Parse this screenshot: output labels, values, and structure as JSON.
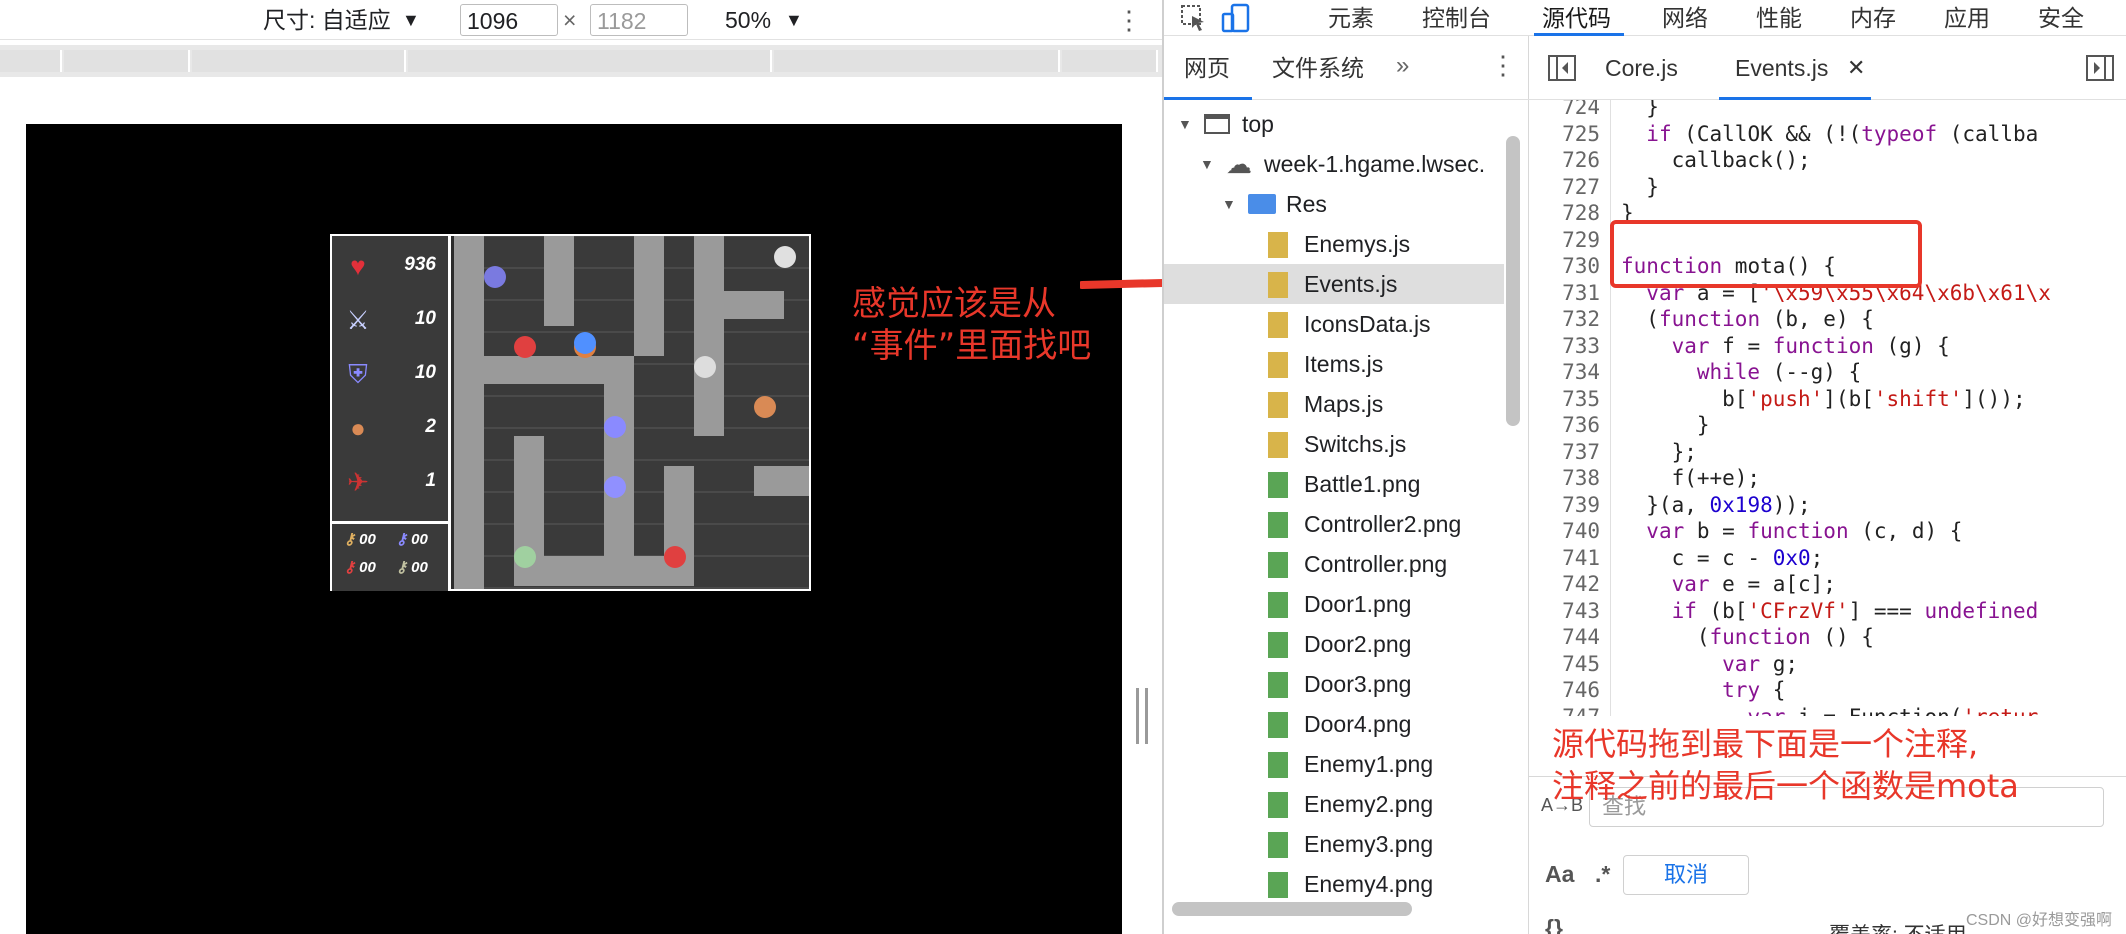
{
  "device_toolbar": {
    "dimensions_label": "尺寸: 自适应",
    "width_value": "1096",
    "height_placeholder": "1182",
    "times_sign": "×",
    "zoom_label": "50%"
  },
  "game": {
    "stats": [
      {
        "icon": "heart-icon",
        "value": "936"
      },
      {
        "icon": "sword-icon",
        "value": "10"
      },
      {
        "icon": "shield-icon",
        "value": "10"
      },
      {
        "icon": "coin-icon",
        "value": "2"
      },
      {
        "icon": "boot-icon",
        "value": "1"
      }
    ],
    "keys": [
      {
        "icon": "yellow-key-icon",
        "value": "00"
      },
      {
        "icon": "blue-key-icon",
        "value": "00"
      },
      {
        "icon": "red-key-icon",
        "value": "00"
      },
      {
        "icon": "green-key-icon",
        "value": "00"
      }
    ]
  },
  "annotations": {
    "left_line1": "感觉应该是从",
    "left_line2": "“事件”里面找吧",
    "right_line1": "源代码拖到最下面是一个注释,",
    "right_line2": "注释之前的最后一个函数是mota"
  },
  "devtools": {
    "tabs": [
      "元素",
      "控制台",
      "源代码",
      "网络",
      "性能",
      "内存",
      "应用",
      "安全"
    ],
    "active_tab": "源代码",
    "navigator": {
      "tabs": [
        "网页",
        "文件系统"
      ],
      "more": "»",
      "tree": [
        {
          "label": "top",
          "indent": 0,
          "icon": "frame-icon",
          "expanded": true
        },
        {
          "label": "week-1.hgame.lwsec.",
          "indent": 1,
          "icon": "cloud-icon",
          "expanded": true
        },
        {
          "label": "Res",
          "indent": 2,
          "icon": "folder-icon",
          "expanded": true
        },
        {
          "label": "Enemys.js",
          "indent": 3,
          "icon": "js-file-icon"
        },
        {
          "label": "Events.js",
          "indent": 3,
          "icon": "js-file-icon",
          "selected": true
        },
        {
          "label": "IconsData.js",
          "indent": 3,
          "icon": "js-file-icon"
        },
        {
          "label": "Items.js",
          "indent": 3,
          "icon": "js-file-icon"
        },
        {
          "label": "Maps.js",
          "indent": 3,
          "icon": "js-file-icon"
        },
        {
          "label": "Switchs.js",
          "indent": 3,
          "icon": "js-file-icon"
        },
        {
          "label": "Battle1.png",
          "indent": 3,
          "icon": "image-file-icon"
        },
        {
          "label": "Controller2.png",
          "indent": 3,
          "icon": "image-file-icon"
        },
        {
          "label": "Controller.png",
          "indent": 3,
          "icon": "image-file-icon"
        },
        {
          "label": "Door1.png",
          "indent": 3,
          "icon": "image-file-icon"
        },
        {
          "label": "Door2.png",
          "indent": 3,
          "icon": "image-file-icon"
        },
        {
          "label": "Door3.png",
          "indent": 3,
          "icon": "image-file-icon"
        },
        {
          "label": "Door4.png",
          "indent": 3,
          "icon": "image-file-icon"
        },
        {
          "label": "Enemy1.png",
          "indent": 3,
          "icon": "image-file-icon"
        },
        {
          "label": "Enemy2.png",
          "indent": 3,
          "icon": "image-file-icon"
        },
        {
          "label": "Enemy3.png",
          "indent": 3,
          "icon": "image-file-icon"
        },
        {
          "label": "Enemy4.png",
          "indent": 3,
          "icon": "image-file-icon"
        }
      ]
    },
    "editor": {
      "tabs": [
        "Core.js",
        "Events.js"
      ],
      "active_tab": "Events.js",
      "lines": [
        {
          "n": "724",
          "text": "  }"
        },
        {
          "n": "725",
          "text": "  if (CallOK && (!(typeof (callba"
        },
        {
          "n": "726",
          "text": "    callback();"
        },
        {
          "n": "727",
          "text": "  }"
        },
        {
          "n": "728",
          "text": "}"
        },
        {
          "n": "729",
          "text": ""
        },
        {
          "n": "730",
          "text": "function mota() {"
        },
        {
          "n": "731",
          "text": "  var a = ['\\x59\\x55\\x64\\x6b\\x61\\x"
        },
        {
          "n": "732",
          "text": "  (function (b, e) {"
        },
        {
          "n": "733",
          "text": "    var f = function (g) {"
        },
        {
          "n": "734",
          "text": "      while (--g) {"
        },
        {
          "n": "735",
          "text": "        b['push'](b['shift']());"
        },
        {
          "n": "736",
          "text": "      }"
        },
        {
          "n": "737",
          "text": "    };"
        },
        {
          "n": "738",
          "text": "    f(++e);"
        },
        {
          "n": "739",
          "text": "  }(a, 0x198));"
        },
        {
          "n": "740",
          "text": "  var b = function (c, d) {"
        },
        {
          "n": "741",
          "text": "    c = c - 0x0;"
        },
        {
          "n": "742",
          "text": "    var e = a[c];"
        },
        {
          "n": "743",
          "text": "    if (b['CFrzVf'] === undefined"
        },
        {
          "n": "744",
          "text": "      (function () {"
        },
        {
          "n": "745",
          "text": "        var g;"
        },
        {
          "n": "746",
          "text": "        try {"
        },
        {
          "n": "747",
          "text": "          var i = Function('retur"
        }
      ]
    },
    "search": {
      "placeholder": "查找",
      "case_toggle": "Aa",
      "regex_toggle": ".*",
      "cancel_label": "取消",
      "pretty_print": "{}",
      "coverage": "覆盖率: 不适用"
    }
  },
  "watermark": "CSDN @好想变强啊",
  "colors": {
    "annotation_red": "#e8372a",
    "accent_blue": "#1a73e8"
  }
}
